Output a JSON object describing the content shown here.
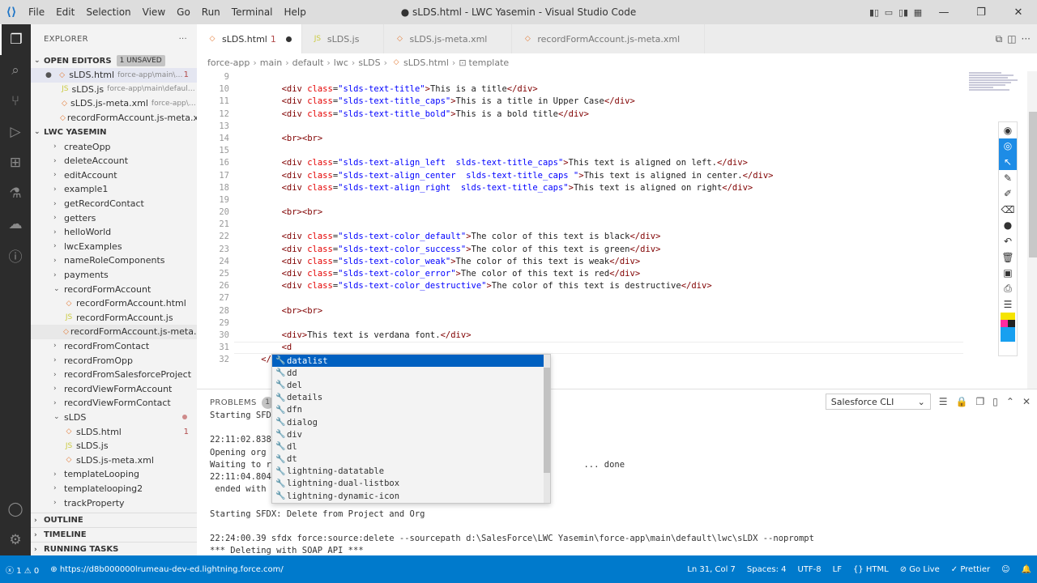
{
  "window": {
    "title": "● sLDS.html - LWC Yasemin - Visual Studio Code",
    "menu": [
      "File",
      "Edit",
      "Selection",
      "View",
      "Go",
      "Run",
      "Terminal",
      "Help"
    ]
  },
  "sidebar": {
    "header": "EXPLORER",
    "open_editors": {
      "label": "OPEN EDITORS",
      "badge": "1 UNSAVED",
      "items": [
        {
          "name": "sLDS.html",
          "desc": "force-app\\main\\d...",
          "count": "1",
          "type": "html"
        },
        {
          "name": "sLDS.js",
          "desc": "force-app\\main\\default\\lw...",
          "type": "js"
        },
        {
          "name": "sLDS.js-meta.xml",
          "desc": "force-app\\mai...",
          "type": "xml"
        },
        {
          "name": "recordFormAccount.js-meta.xm...",
          "desc": "",
          "type": "xml"
        }
      ]
    },
    "project": {
      "label": "LWC YASEMIN",
      "items": [
        {
          "name": "createOpp",
          "level": 1,
          "kind": "folder"
        },
        {
          "name": "deleteAccount",
          "level": 1,
          "kind": "folder"
        },
        {
          "name": "editAccount",
          "level": 1,
          "kind": "folder"
        },
        {
          "name": "example1",
          "level": 1,
          "kind": "folder"
        },
        {
          "name": "getRecordContact",
          "level": 1,
          "kind": "folder"
        },
        {
          "name": "getters",
          "level": 1,
          "kind": "folder"
        },
        {
          "name": "helloWorld",
          "level": 1,
          "kind": "folder"
        },
        {
          "name": "lwcExamples",
          "level": 1,
          "kind": "folder"
        },
        {
          "name": "nameRoleComponents",
          "level": 1,
          "kind": "folder"
        },
        {
          "name": "payments",
          "level": 1,
          "kind": "folder"
        },
        {
          "name": "recordFormAccount",
          "level": 1,
          "kind": "open"
        },
        {
          "name": "recordFormAccount.html",
          "level": 2,
          "kind": "html"
        },
        {
          "name": "recordFormAccount.js",
          "level": 2,
          "kind": "js"
        },
        {
          "name": "recordFormAccount.js-meta.xml",
          "level": 2,
          "kind": "xml"
        },
        {
          "name": "recordFromContact",
          "level": 1,
          "kind": "folder"
        },
        {
          "name": "recordFromOpp",
          "level": 1,
          "kind": "folder"
        },
        {
          "name": "recordFromSalesforceProject",
          "level": 1,
          "kind": "folder"
        },
        {
          "name": "recordViewFormAccount",
          "level": 1,
          "kind": "folder"
        },
        {
          "name": "recordViewFormContact",
          "level": 1,
          "kind": "folder"
        },
        {
          "name": "sLDS",
          "level": 1,
          "kind": "open"
        },
        {
          "name": "sLDS.html",
          "level": 2,
          "kind": "html",
          "count": "1"
        },
        {
          "name": "sLDS.js",
          "level": 2,
          "kind": "js"
        },
        {
          "name": "sLDS.js-meta.xml",
          "level": 2,
          "kind": "xml"
        },
        {
          "name": "templateLooping",
          "level": 1,
          "kind": "folder"
        },
        {
          "name": "templatelooping2",
          "level": 1,
          "kind": "folder"
        },
        {
          "name": "trackProperty",
          "level": 1,
          "kind": "folder"
        }
      ]
    },
    "outline": "OUTLINE",
    "timeline": "TIMELINE",
    "running_tasks": "RUNNING TASKS"
  },
  "tabs": [
    {
      "label": "sLDS.html",
      "suffix": "1",
      "type": "html",
      "active": true
    },
    {
      "label": "sLDS.js",
      "type": "js"
    },
    {
      "label": "sLDS.js-meta.xml",
      "type": "xml"
    },
    {
      "label": "recordFormAccount.js-meta.xml",
      "type": "xml"
    }
  ],
  "breadcrumb": [
    "force-app",
    "main",
    "default",
    "lwc",
    "sLDS",
    "sLDS.html",
    "template"
  ],
  "editor": {
    "lines": [
      {
        "n": "9",
        "t": ""
      },
      {
        "n": "10",
        "t": "        <div class=\"slds-text-title\">This is a title</div>"
      },
      {
        "n": "11",
        "t": "        <div class=\"slds-text-title_caps\">This is a title in Upper Case</div>"
      },
      {
        "n": "12",
        "t": "        <div class=\"slds-text-title_bold\">This is a bold title</div>"
      },
      {
        "n": "13",
        "t": ""
      },
      {
        "n": "14",
        "t": "        <br><br>"
      },
      {
        "n": "15",
        "t": ""
      },
      {
        "n": "16",
        "t": "        <div class=\"slds-text-align_left  slds-text-title_caps\">This text is aligned on left.</div>"
      },
      {
        "n": "17",
        "t": "        <div class=\"slds-text-align_center  slds-text-title_caps \">This text is aligned in center.</div>"
      },
      {
        "n": "18",
        "t": "        <div class=\"slds-text-align_right  slds-text-title_caps\">This text is aligned on right</div>"
      },
      {
        "n": "19",
        "t": ""
      },
      {
        "n": "20",
        "t": "        <br><br>"
      },
      {
        "n": "21",
        "t": ""
      },
      {
        "n": "22",
        "t": "        <div class=\"slds-text-color_default\">The color of this text is black</div>"
      },
      {
        "n": "23",
        "t": "        <div class=\"slds-text-color_success\">The color of this text is green</div>"
      },
      {
        "n": "24",
        "t": "        <div class=\"slds-text-color_weak\">The color of this text is weak</div>"
      },
      {
        "n": "25",
        "t": "        <div class=\"slds-text-color_error\">The color of this text is red</div>"
      },
      {
        "n": "26",
        "t": "        <div class=\"slds-text-color_destructive\">The color of this text is destructive</div>"
      },
      {
        "n": "27",
        "t": ""
      },
      {
        "n": "28",
        "t": "        <br><br>"
      },
      {
        "n": "29",
        "t": ""
      },
      {
        "n": "30",
        "t": "        <div>This text is verdana font.</div>"
      },
      {
        "n": "31",
        "t": "        <d"
      },
      {
        "n": "32",
        "t": "    </temp"
      }
    ]
  },
  "suggestions": [
    "datalist",
    "dd",
    "del",
    "details",
    "dfn",
    "dialog",
    "div",
    "dl",
    "dt",
    "lightning-datatable",
    "lightning-dual-listbox",
    "lightning-dynamic-icon"
  ],
  "panel": {
    "tab": "PROBLEMS",
    "count": "1",
    "dropdown": "Salesforce CLI",
    "lines": [
      "Starting SFD",
      "",
      "22:11:02.838",
      "Opening org (",
      "Waiting to re                                                            ... done",
      "22:11:04.804",
      " ended with (",
      "",
      "Starting SFDX: Delete from Project and Org",
      "",
      "22:24:00.39 sfdx force:source:delete --sourcepath d:\\SalesForce\\LWC Yasemin\\force-app\\main\\default\\lwc\\sLDX --noprompt",
      "*** Deleting with SOAP API ***"
    ]
  },
  "statusbar": {
    "errors": "1",
    "warnings": "0",
    "url": "https://d8b000000lrumeau-dev-ed.lightning.force.com/",
    "position": "Ln 31, Col 7",
    "spaces": "Spaces: 4",
    "encoding": "UTF-8",
    "eol": "LF",
    "language": "HTML",
    "golive": "Go Live",
    "prettier": "Prettier"
  },
  "colors": {
    "accent": "#007acc",
    "selection": "#0060c0"
  }
}
